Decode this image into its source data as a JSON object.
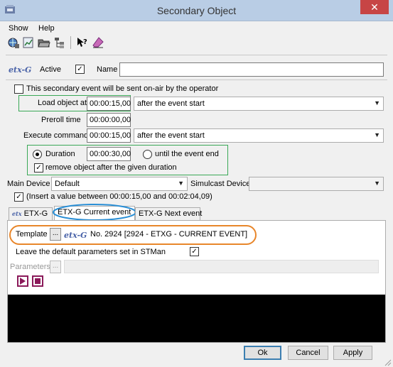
{
  "window": {
    "title": "Secondary Object",
    "close_label": "✕"
  },
  "menu": {
    "show": "Show",
    "help": "Help"
  },
  "toolbar": {
    "icons": [
      "globe-icon",
      "graph-icon",
      "open-folder-icon",
      "tree-icon",
      "help-pointer-icon",
      "eraser-icon"
    ]
  },
  "header": {
    "logo": "etx-G",
    "active_label": "Active",
    "active_checked": true,
    "name_label": "Name",
    "name_value": ""
  },
  "on_air": {
    "label": "This secondary event will be sent on-air by the operator",
    "checked": false
  },
  "load_object": {
    "label": "Load object at",
    "time": "00:00:15,00",
    "mode": "after the event start"
  },
  "preroll": {
    "label": "Preroll time",
    "time": "00:00:00,00"
  },
  "execute": {
    "label": "Execute command",
    "time": "00:00:15,00",
    "mode": "after the event start"
  },
  "duration": {
    "duration_label": "Duration",
    "duration_selected": true,
    "time": "00:00:30,00",
    "until_end_label": "until the event end",
    "remove_label": "remove object after the given duration",
    "remove_checked": true
  },
  "devices": {
    "main_label": "Main Device",
    "main_value": "Default",
    "simulcast_label": "Simulcast Device",
    "simulcast_value": ""
  },
  "range_hint": {
    "label": "(Insert a value between 00:00:15,00 and 00:02:04,09)",
    "checked": true
  },
  "tabs": [
    {
      "label": "ETX-G",
      "logo": "etx"
    },
    {
      "label": "ETX-G Current event"
    },
    {
      "label": "ETX-G Next event"
    }
  ],
  "template": {
    "label": "Template",
    "browse": "...",
    "logo": "etx-G",
    "value": "No. 2924 [2924 - ETXG - CURRENT EVENT]"
  },
  "defaults": {
    "label": "Leave the default parameters set in STMan",
    "checked": true
  },
  "parameters": {
    "label": "Parameters",
    "browse": "..."
  },
  "buttons": {
    "ok": "Ok",
    "cancel": "Cancel",
    "apply": "Apply"
  },
  "colors": {
    "highlight_orange": "#e8862a",
    "highlight_blue": "#2a8fd6",
    "highlight_green": "#3aa856",
    "play_button": "#8b1a5a"
  }
}
